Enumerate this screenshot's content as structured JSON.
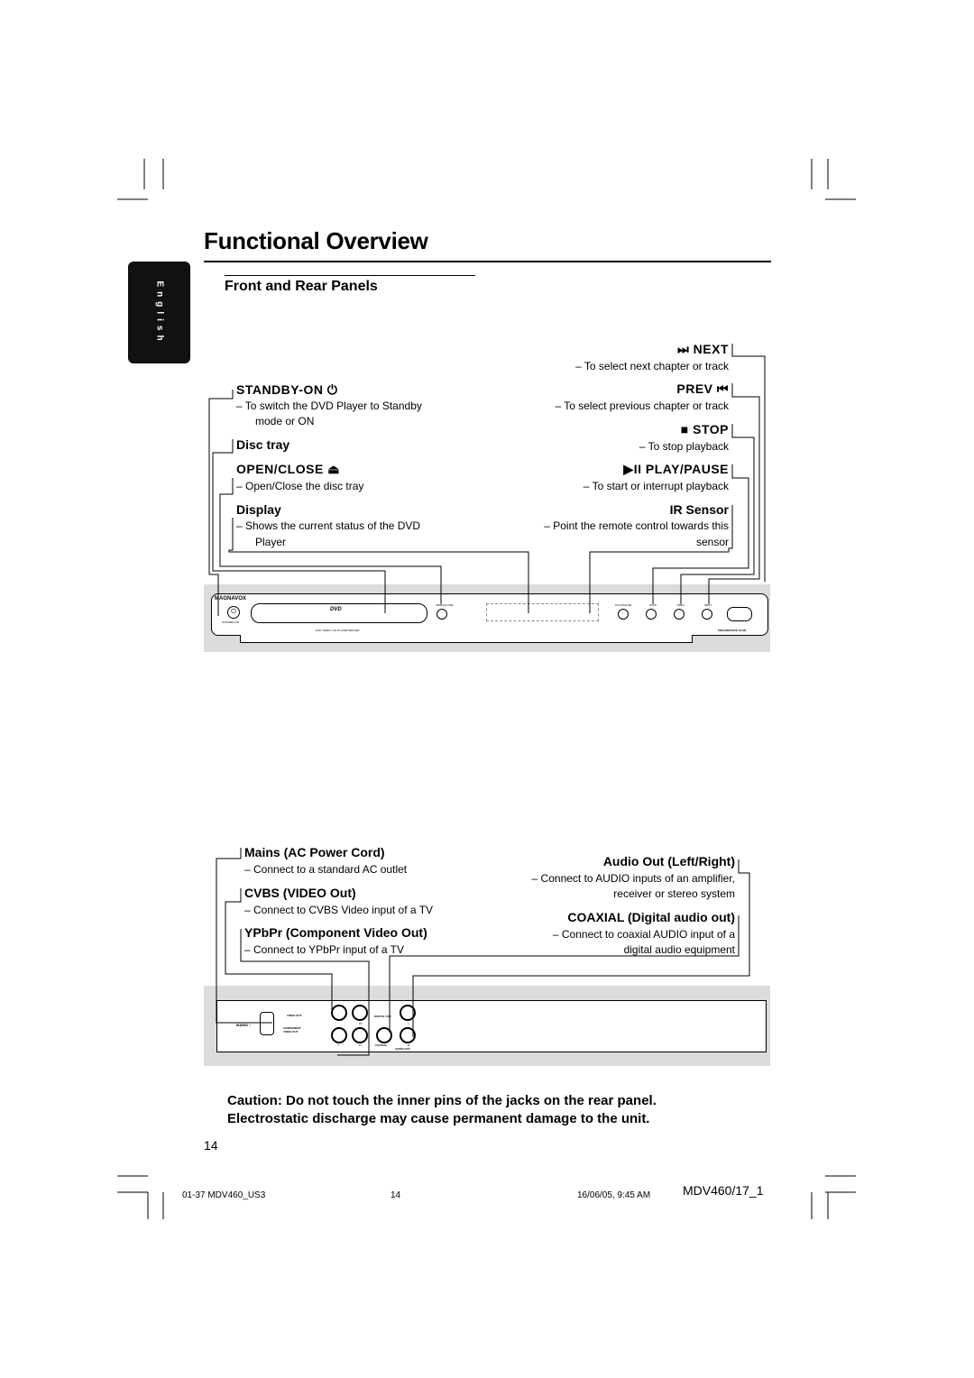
{
  "page_title": "Functional Overview",
  "language_tab": "English",
  "section_title": "Front and Rear Panels",
  "front_left": [
    {
      "label": "STANDBY-ON",
      "icon": "power-icon",
      "desc": [
        "–  To switch the DVD Player to Standby",
        "mode or ON"
      ]
    },
    {
      "label": "Disc tray",
      "desc": []
    },
    {
      "label": "OPEN/CLOSE",
      "icon": "eject-icon",
      "desc": [
        "–  Open/Close the disc tray"
      ]
    },
    {
      "label": "Display",
      "desc": [
        "–  Shows the current status of the DVD",
        "Player"
      ]
    }
  ],
  "front_right": [
    {
      "label": "NEXT",
      "icon": "next-icon",
      "desc": [
        "– To select next chapter or track"
      ]
    },
    {
      "label": "PREV",
      "icon": "prev-icon",
      "desc": [
        "– To select previous chapter or track"
      ]
    },
    {
      "label": "STOP",
      "icon": "stop-icon",
      "desc": [
        "– To stop playback"
      ]
    },
    {
      "label": "PLAY/PAUSE",
      "icon": "play-pause-icon",
      "desc": [
        "– To start or interrupt playback"
      ]
    },
    {
      "label": "IR Sensor",
      "desc": [
        "–  Point the remote control towards this",
        "sensor"
      ]
    }
  ],
  "front_panel": {
    "brand": "MAGNAVOX",
    "standby": "STANDBY-ON",
    "dvd_logo": "DVD",
    "model_text": "DVD VIDEO / CD PLAYER  MDV460",
    "open_close": "OPEN/CLOSE",
    "play_pause": "PLAY/PAUSE",
    "stop": "STOP",
    "prev": "PREV",
    "next": "NEXT",
    "progressive": "PROGRESSIVE SCAN"
  },
  "rear_left": [
    {
      "label": "Mains (AC Power Cord)",
      "desc": [
        "–  Connect to a standard AC outlet"
      ]
    },
    {
      "label": "CVBS (VIDEO Out)",
      "desc": [
        "–  Connect to CVBS Video input of a TV"
      ]
    },
    {
      "label": "YPbPr (Component Video Out)",
      "desc": [
        "–  Connect to YPbPr input of a TV"
      ]
    }
  ],
  "rear_right": [
    {
      "label": "Audio Out (Left/Right)",
      "desc": [
        "– Connect to AUDIO inputs of an amplifier,",
        "receiver or stereo system"
      ]
    },
    {
      "label": "COAXIAL (Digital audio out)",
      "desc": [
        "–  Connect to coaxial AUDIO input of a",
        "digital audio equipment"
      ]
    }
  ],
  "rear_panel": {
    "mains": "MAINS ~",
    "video_out": "VIDEO OUT",
    "component": "COMPONENT VIDEO OUT",
    "digital_out": "DIGITAL OUT",
    "coaxial": "COAXIAL",
    "audio_out": "AUDIO OUT",
    "y": "Y",
    "pb": "Pb",
    "pr": "Pr",
    "l": "L",
    "r": "R"
  },
  "caution": [
    "Caution: Do not touch the inner pins of the jacks on the rear panel.",
    "Electrostatic discharge may cause permanent damage to the unit."
  ],
  "page_number": "14",
  "footer": {
    "left": "01-37 MDV460_US3",
    "center": "14",
    "date": "16/06/05, 9:45 AM",
    "model": "MDV460/17_1"
  }
}
